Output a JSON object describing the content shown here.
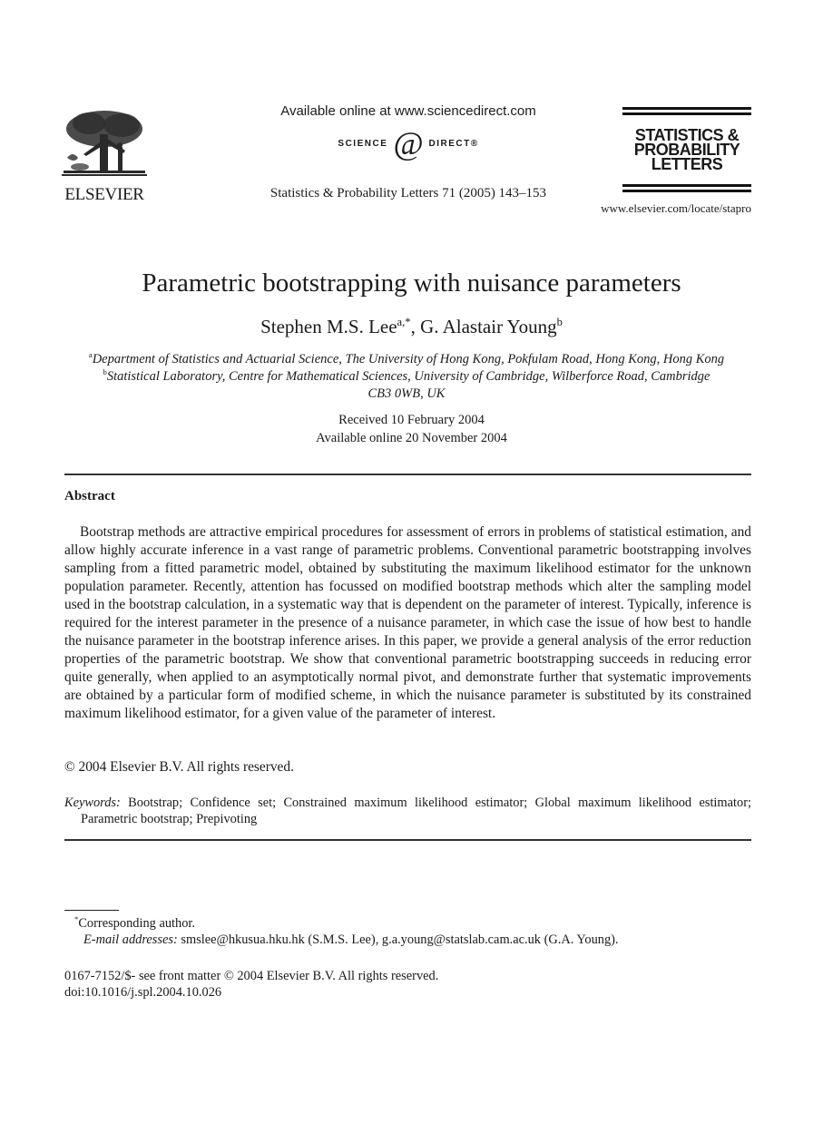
{
  "header": {
    "publisher_logo_text": "ELSEVIER",
    "available_online": "Available online at www.sciencedirect.com",
    "sciencedirect_logo": {
      "left": "SCIENCE",
      "symbol": "d",
      "right": "DIRECT®"
    },
    "journal_reference": "Statistics & Probability Letters 71 (2005) 143–153",
    "journal_logo_lines": [
      "STATISTICS &",
      "PROBABILITY",
      "LETTERS"
    ],
    "journal_url": "www.elsevier.com/locate/stapro"
  },
  "article": {
    "title": "Parametric bootstrapping with nuisance parameters",
    "authors": [
      {
        "name": "Stephen M.S. Lee",
        "marks": "a,*",
        "sep": ", "
      },
      {
        "name": "G. Alastair Young",
        "marks": "b",
        "sep": ""
      }
    ],
    "affiliations": [
      {
        "mark": "a",
        "text": "Department of Statistics and Actuarial Science, The University of Hong Kong, Pokfulam Road, Hong Kong, Hong Kong"
      },
      {
        "mark": "b",
        "text": "Statistical Laboratory, Centre for Mathematical Sciences, University of Cambridge, Wilberforce Road, Cambridge CB3 0WB, UK"
      }
    ],
    "received": "Received 10 February 2004",
    "available_online": "Available online 20 November 2004"
  },
  "abstract": {
    "heading": "Abstract",
    "body": "Bootstrap methods are attractive empirical procedures for assessment of errors in problems of statistical estimation, and allow highly accurate inference in a vast range of parametric problems. Conventional parametric bootstrapping involves sampling from a fitted parametric model, obtained by substituting the maximum likelihood estimator for the unknown population parameter. Recently, attention has focussed on modified bootstrap methods which alter the sampling model used in the bootstrap calculation, in a systematic way that is dependent on the parameter of interest. Typically, inference is required for the interest parameter in the presence of a nuisance parameter, in which case the issue of how best to handle the nuisance parameter in the bootstrap inference arises. In this paper, we provide a general analysis of the error reduction properties of the parametric bootstrap. We show that conventional parametric bootstrapping succeeds in reducing error quite generally, when applied to an asymptotically normal pivot, and demonstrate further that systematic improvements are obtained by a particular form of modified scheme, in which the nuisance parameter is substituted by its constrained maximum likelihood estimator, for a given value of the parameter of interest.",
    "copyright": "© 2004 Elsevier B.V. All rights reserved."
  },
  "keywords": {
    "label": "Keywords:",
    "text": "Bootstrap; Confidence set; Constrained maximum likelihood estimator; Global maximum likelihood estimator; Parametric bootstrap; Prepivoting"
  },
  "footnotes": {
    "corresponding_mark": "*",
    "corresponding": "Corresponding author.",
    "email_label": "E-mail addresses:",
    "emails": "smslee@hkusua.hku.hk (S.M.S. Lee), g.a.young@statslab.cam.ac.uk (G.A. Young)."
  },
  "front_matter": {
    "issn_line": "0167-7152/$- see front matter © 2004 Elsevier B.V. All rights reserved.",
    "doi": "doi:10.1016/j.spl.2004.10.026"
  }
}
